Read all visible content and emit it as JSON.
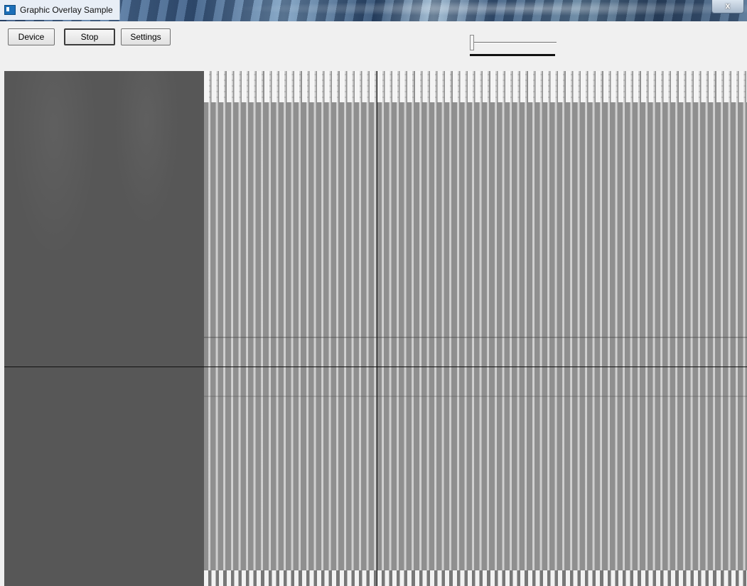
{
  "window": {
    "title": "Graphic Overlay Sample",
    "close_label": "x",
    "app_icon": "app-window-icon"
  },
  "toolbar": {
    "device_label": "Device",
    "stop_label": "Stop",
    "settings_label": "Settings"
  },
  "slider": {
    "value_fraction": 0.0
  },
  "camera_view": {
    "overlay": "crosshair"
  }
}
